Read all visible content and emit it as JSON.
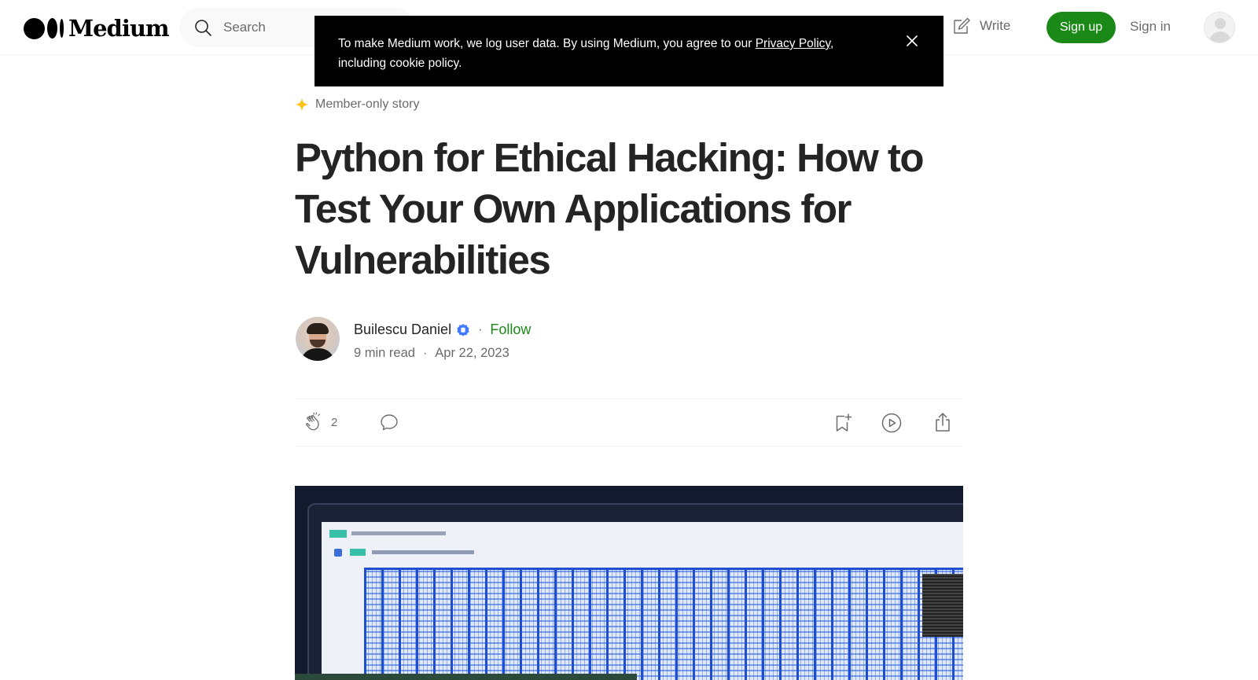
{
  "header": {
    "logo_text": "Medium",
    "search_placeholder": "Search",
    "write_label": "Write",
    "signup_label": "Sign up",
    "signin_label": "Sign in"
  },
  "cookie_banner": {
    "text_before_link": "To make Medium work, we log user data. By using Medium, you agree to our ",
    "link_text": "Privacy Policy",
    "text_after_link": ", including cookie policy."
  },
  "article": {
    "member_label": "Member-only story",
    "title": "Python for Ethical Hacking: How to Test Your Own Applications for Vulnerabilities",
    "author": {
      "name": "Builescu Daniel",
      "follow_label": "Follow",
      "separator": "·"
    },
    "read_time": "9 min read",
    "date": "Apr 22, 2023",
    "clap_count": "2"
  },
  "colors": {
    "accent_green": "#1a8917",
    "member_star": "#ffc017",
    "verified_blue": "#437aff",
    "text_primary": "#242424",
    "text_secondary": "#6b6b6b"
  },
  "icons": [
    "search-icon",
    "write-icon",
    "close-icon",
    "star-icon",
    "verified-icon",
    "clap-icon",
    "comment-icon",
    "bookmark-add-icon",
    "play-icon",
    "share-icon"
  ]
}
